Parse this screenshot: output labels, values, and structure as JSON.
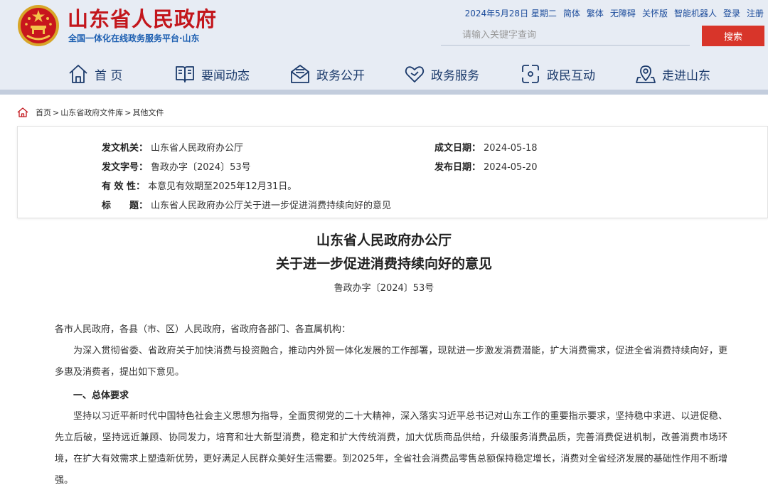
{
  "header": {
    "title": "山东省人民政府",
    "subtitle": "全国一体化在线政务服务平台·山东",
    "date": "2024年5月28日 星期二",
    "links": [
      "简体",
      "繁体",
      "无障碍",
      "关怀版",
      "智能机器人"
    ],
    "login": "登录",
    "register": "注册",
    "search_placeholder": "请输入关键字查询",
    "search_button": "搜索"
  },
  "nav": [
    {
      "label": "首 页",
      "icon": "home-icon"
    },
    {
      "label": "要闻动态",
      "icon": "book-icon"
    },
    {
      "label": "政务公开",
      "icon": "mail-icon"
    },
    {
      "label": "政务服务",
      "icon": "heart-icon"
    },
    {
      "label": "政民互动",
      "icon": "exchange-icon"
    },
    {
      "label": "走进山东",
      "icon": "location-icon"
    }
  ],
  "breadcrumb": [
    "首页",
    "山东省政府文件库",
    "其他文件"
  ],
  "info": {
    "issuer_label": "发文机关：",
    "issuer": "山东省人民政府办公厅",
    "doc_no_label": "发文字号：",
    "doc_no": "鲁政办字〔2024〕53号",
    "validity_label": "有 效 性：",
    "validity": "本意见有效期至2025年12月31日。",
    "title_label": "标　　题：",
    "title": "山东省人民政府办公厅关于进一步促进消费持续向好的意见",
    "created_label": "成文日期：",
    "created": "2024-05-18",
    "published_label": "发布日期：",
    "published": "2024-05-20"
  },
  "article": {
    "title_line1": "山东省人民政府办公厅",
    "title_line2": "关于进一步促进消费持续向好的意见",
    "doc_no": "鲁政办字〔2024〕53号",
    "salutation": "各市人民政府，各县（市、区）人民政府，省政府各部门、各直属机构：",
    "intro": "为深入贯彻省委、省政府关于加快消费与投资融合，推动内外贸一体化发展的工作部署，现就进一步激发消费潜能，扩大消费需求，促进全省消费持续向好，更多惠及消费者，提出如下意见。",
    "section1_heading": "一、总体要求",
    "section1_body": "坚持以习近平新时代中国特色社会主义思想为指导，全面贯彻党的二十大精神，深入落实习近平总书记对山东工作的重要指示要求，坚持稳中求进、以进促稳、先立后破，坚持远近兼顾、协同发力，培育和壮大新型消费，稳定和扩大传统消费，加大优质商品供给，升级服务消费品质，完善消费促进机制，改善消费市场环境，在扩大有效需求上塑造新优势，更好满足人民群众美好生活需要。到2025年，全省社会消费品零售总额保持稳定增长，消费对全省经济发展的基础性作用不断增强。"
  },
  "colors": {
    "brand_red": "#c3161c",
    "nav_blue": "#1b3a6b",
    "header_bg": "#e7ecf4",
    "search_btn": "#d8352a"
  }
}
